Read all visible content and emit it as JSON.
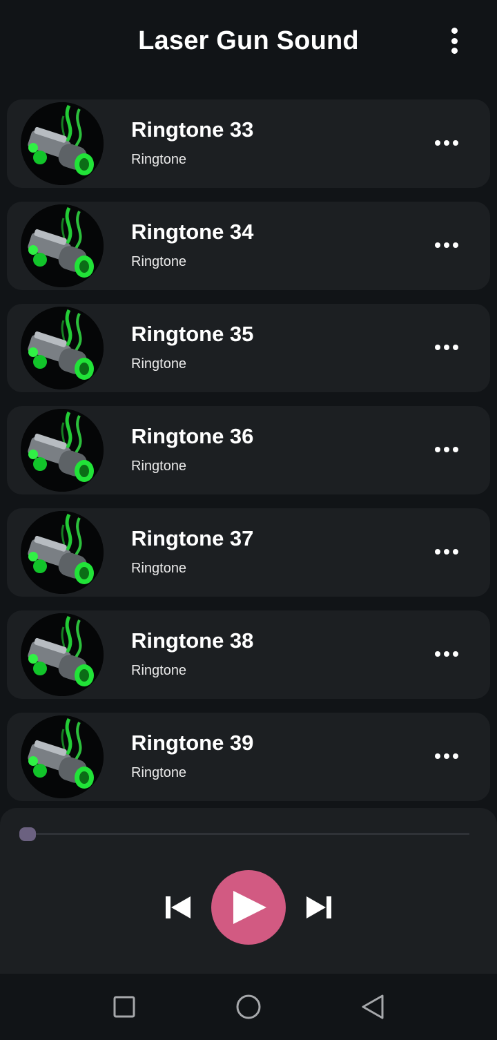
{
  "app": {
    "title": "Laser Gun Sound"
  },
  "ringtones": [
    {
      "title": "Ringtone 33",
      "subtitle": "Ringtone"
    },
    {
      "title": "Ringtone 34",
      "subtitle": "Ringtone"
    },
    {
      "title": "Ringtone 35",
      "subtitle": "Ringtone"
    },
    {
      "title": "Ringtone 36",
      "subtitle": "Ringtone"
    },
    {
      "title": "Ringtone 37",
      "subtitle": "Ringtone"
    },
    {
      "title": "Ringtone 38",
      "subtitle": "Ringtone"
    },
    {
      "title": "Ringtone 39",
      "subtitle": "Ringtone"
    }
  ],
  "player": {
    "progress": 0
  },
  "colors": {
    "background": "#111417",
    "card": "#1c1f22",
    "accent": "#d25a82",
    "seek_thumb": "#6b6180",
    "thumbnail_glow": "#27e33c"
  },
  "icons": {
    "menu": "more-vert-icon",
    "item_menu": "more-horiz-icon",
    "thumbnail": "laser-gun-thumbnail",
    "prev": "skip-previous-icon",
    "play": "play-icon",
    "next": "skip-next-icon",
    "nav_recents": "square-icon",
    "nav_home": "circle-icon",
    "nav_back": "triangle-back-icon"
  }
}
